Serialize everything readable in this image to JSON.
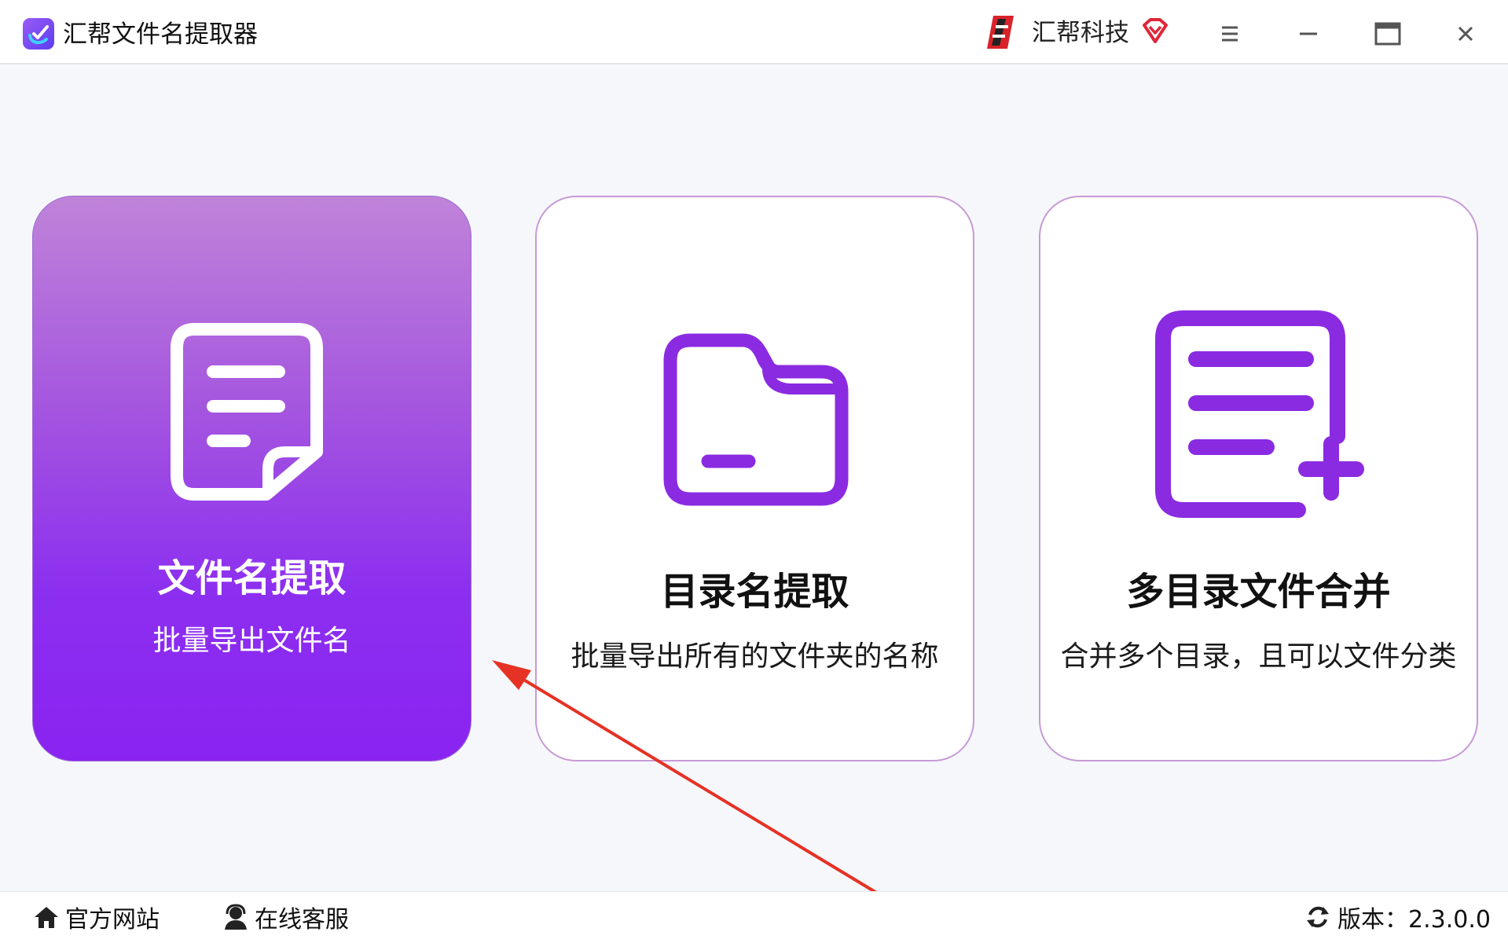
{
  "app": {
    "title": "汇帮文件名提取器"
  },
  "brand": {
    "name": "汇帮科技"
  },
  "window_controls": [
    "menu-icon",
    "minimize-icon",
    "maximize-icon",
    "close-icon"
  ],
  "cards": [
    {
      "title": "文件名提取",
      "desc": "批量导出文件名",
      "icon": "document-icon",
      "selected": true
    },
    {
      "title": "目录名提取",
      "desc": "批量导出所有的文件夹的名称",
      "icon": "folder-icon",
      "selected": false
    },
    {
      "title": "多目录文件合并",
      "desc": "合并多个目录，且可以文件分类",
      "icon": "list-add-icon",
      "selected": false
    }
  ],
  "footer": {
    "website": "官方网站",
    "support": "在线客服",
    "version": "版本：2.3.0.0"
  },
  "colors": {
    "accent": "#8a2be2",
    "card_gradient_top": "#c083d9",
    "card_gradient_bottom": "#8a23f0",
    "card_border": "#c79ad6",
    "annotation_arrow": "#e53225"
  }
}
